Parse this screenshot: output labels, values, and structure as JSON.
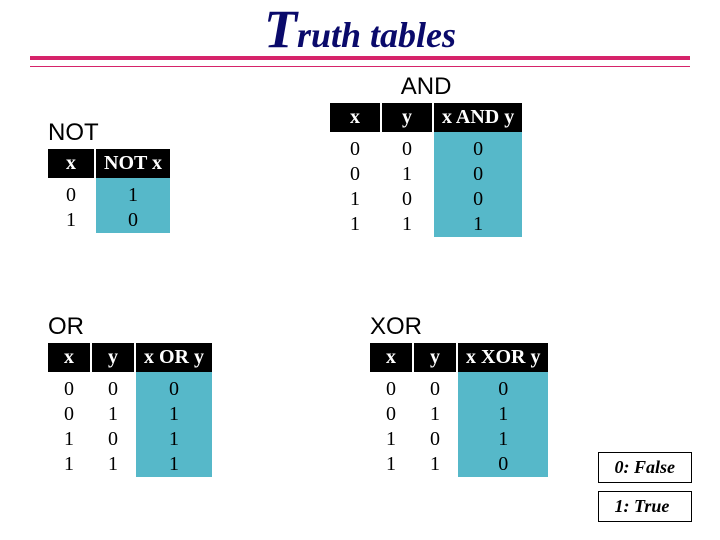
{
  "title": {
    "first_letter": "T",
    "rest": "ruth tables"
  },
  "tables": {
    "and": {
      "label": "AND",
      "headers": [
        "x",
        "y",
        "x AND y"
      ],
      "rows": [
        [
          "0",
          "0",
          "0"
        ],
        [
          "0",
          "1",
          "0"
        ],
        [
          "1",
          "0",
          "0"
        ],
        [
          "1",
          "1",
          "1"
        ]
      ]
    },
    "not": {
      "label": "NOT",
      "headers": [
        "x",
        "NOT x"
      ],
      "rows": [
        [
          "0",
          "1"
        ],
        [
          "1",
          "0"
        ]
      ]
    },
    "or": {
      "label": "OR",
      "headers": [
        "x",
        "y",
        "x  OR  y"
      ],
      "rows": [
        [
          "0",
          "0",
          "0"
        ],
        [
          "0",
          "1",
          "1"
        ],
        [
          "1",
          "0",
          "1"
        ],
        [
          "1",
          "1",
          "1"
        ]
      ]
    },
    "xor": {
      "label": "XOR",
      "headers": [
        "x",
        "y",
        "x  XOR y"
      ],
      "rows": [
        [
          "0",
          "0",
          "0"
        ],
        [
          "0",
          "1",
          "1"
        ],
        [
          "1",
          "0",
          "1"
        ],
        [
          "1",
          "1",
          "0"
        ]
      ]
    }
  },
  "legend": {
    "false": "0: False",
    "true": "1: True"
  }
}
